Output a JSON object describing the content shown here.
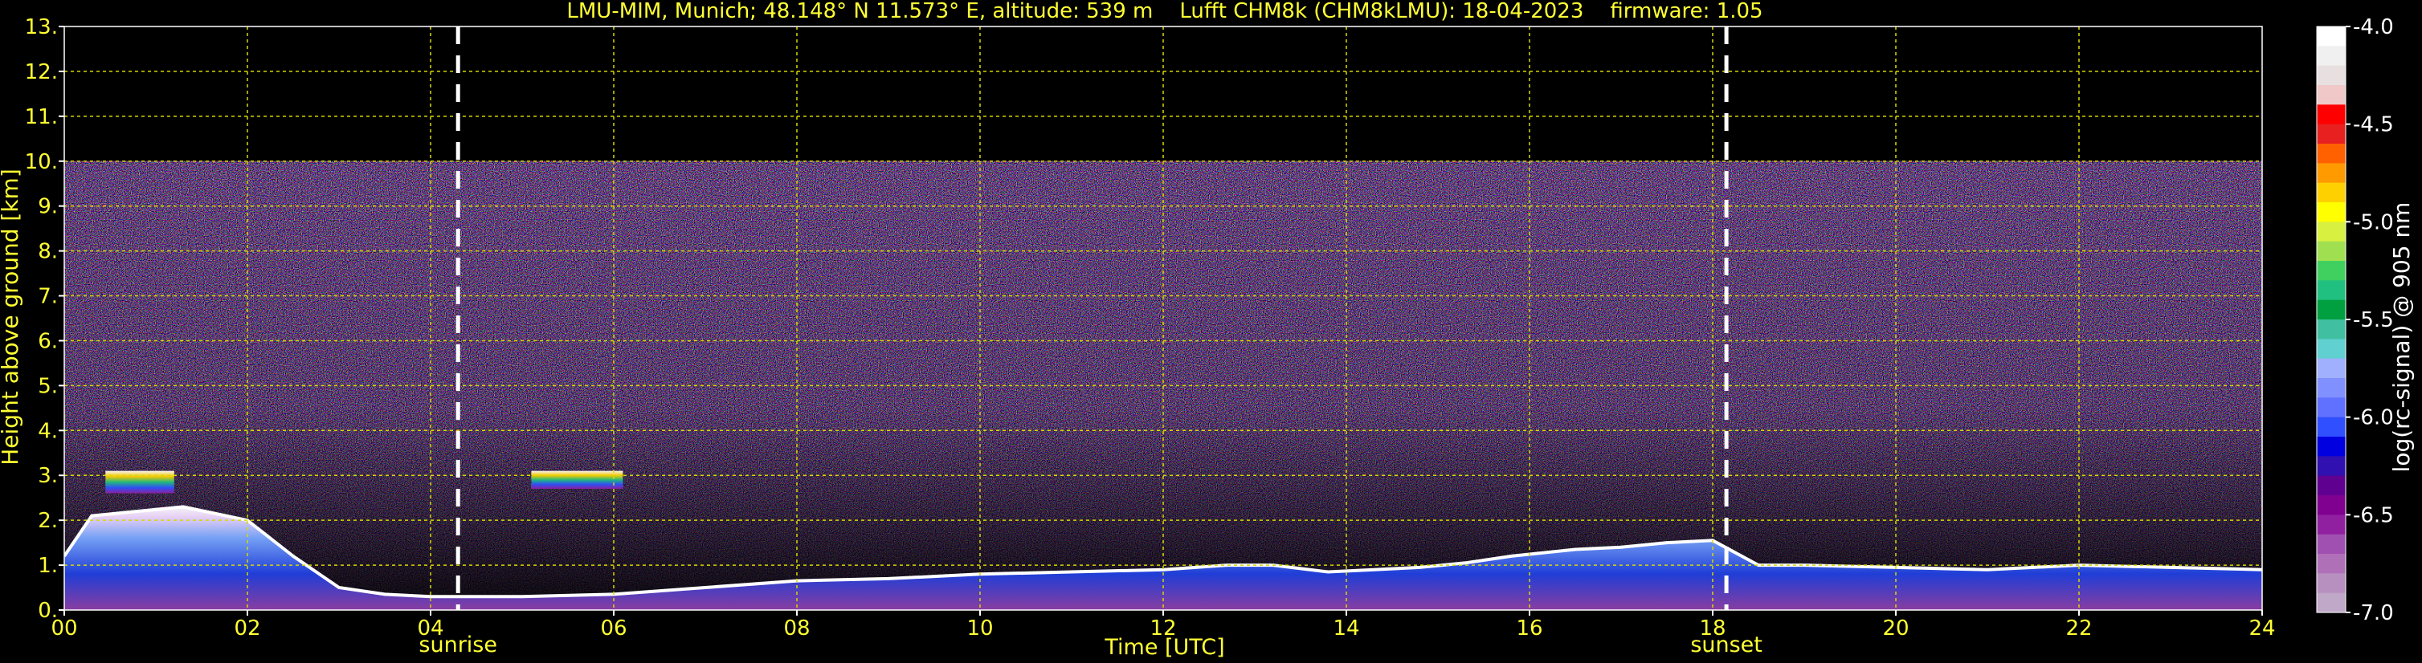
{
  "chart_data": {
    "type": "heatmap",
    "title": "LMU-MIM, Munich; 48.148° N 11.573° E, altitude: 539 m    Lufft CHM8k (CHM8kLMU): 18-04-2023    firmware: 1.05",
    "xlabel": "Time [UTC]",
    "ylabel": "Height above ground [km]",
    "xlim": [
      0,
      24
    ],
    "ylim": [
      0,
      13
    ],
    "x_ticks": [
      "00",
      "02",
      "04",
      "06",
      "08",
      "10",
      "12",
      "14",
      "16",
      "18",
      "20",
      "22",
      "24"
    ],
    "y_ticks": [
      "0.",
      "1.",
      "2.",
      "3.",
      "4.",
      "5.",
      "6.",
      "7.",
      "8.",
      "9.",
      "10.",
      "11.",
      "12.",
      "13."
    ],
    "grid": true,
    "data_max_height_km": 10,
    "sunrise": {
      "time": 4.3,
      "label": "sunrise"
    },
    "sunset": {
      "time": 18.15,
      "label": "sunset"
    },
    "colorbar": {
      "label": "log(rc-signal) @ 905 nm",
      "range": [
        -7.0,
        -4.0
      ],
      "tick_values": [
        -4.0,
        -4.5,
        -5.0,
        -5.5,
        -6.0,
        -6.5,
        -7.0
      ],
      "tick_labels": [
        "-4.0",
        "-4.5",
        "-5.0",
        "-5.5",
        "-6.0",
        "-6.5",
        "-7.0"
      ],
      "colors": [
        "#ffffff",
        "#f0f0f0",
        "#e8e0e0",
        "#f0c8c8",
        "#ff0000",
        "#e82020",
        "#ff6000",
        "#ff9a00",
        "#ffd000",
        "#ffff00",
        "#d8f040",
        "#a0e050",
        "#40d060",
        "#20c080",
        "#00a040",
        "#40c0a0",
        "#60d0d0",
        "#a0b0ff",
        "#8090ff",
        "#6070ff",
        "#3050ff",
        "#0000e0",
        "#3010b0",
        "#600090",
        "#800090",
        "#9020a0",
        "#a050b0",
        "#b070b8",
        "#b890c0",
        "#c0a8c8"
      ]
    },
    "features": [
      {
        "name": "boundary layer top",
        "x": [
          0,
          0.3,
          0.8,
          1.3,
          2,
          2.5,
          3,
          3.5,
          4,
          5,
          6,
          7,
          8,
          9,
          10,
          11,
          12,
          12.7,
          13.2,
          13.8,
          14.3,
          14.8,
          15.3,
          15.8,
          16.5,
          17,
          17.5,
          18,
          18.5,
          19,
          20,
          21,
          22,
          23,
          24
        ],
        "y": [
          1.2,
          2.1,
          2.2,
          2.3,
          2.0,
          1.2,
          0.5,
          0.35,
          0.3,
          0.3,
          0.35,
          0.5,
          0.65,
          0.7,
          0.8,
          0.85,
          0.9,
          1.0,
          1.0,
          0.85,
          0.9,
          0.95,
          1.05,
          1.2,
          1.35,
          1.4,
          1.5,
          1.55,
          1.0,
          1.0,
          0.95,
          0.9,
          1.0,
          0.95,
          0.9
        ]
      },
      {
        "name": "cloud layer",
        "x": [
          0.45,
          1.2
        ],
        "y": [
          2.6,
          3.1
        ]
      },
      {
        "name": "cloud layer",
        "x": [
          5.1,
          6.1
        ],
        "y": [
          2.7,
          3.1
        ]
      }
    ]
  }
}
